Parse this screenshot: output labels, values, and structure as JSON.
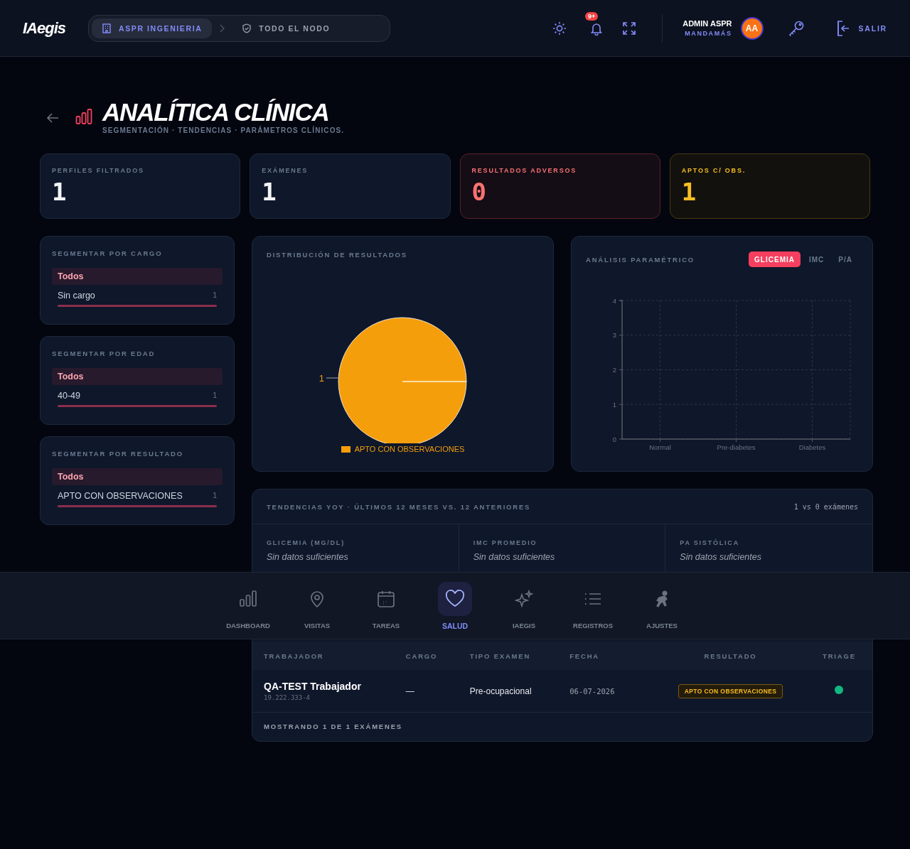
{
  "header": {
    "logo": "IAegis",
    "breadcrumb": [
      {
        "label": "ASPR INGENIERIA",
        "selected": true
      },
      {
        "label": "TODO EL NODO",
        "selected": false
      }
    ],
    "notifications": "9+",
    "user": {
      "name": "ADMIN ASPR",
      "role": "MANDAMÁS",
      "initials": "AA"
    },
    "logout": "SALIR"
  },
  "page": {
    "title": "ANALÍTICA CLÍNICA",
    "subtitle": "SEGMENTACIÓN · TENDENCIAS · PARÁMETROS CLÍNICOS."
  },
  "stats": [
    {
      "label": "PERFILES FILTRADOS",
      "value": "1",
      "kind": "neutral"
    },
    {
      "label": "EXÁMENES",
      "value": "1",
      "kind": "neutral"
    },
    {
      "label": "RESULTADOS ADVERSOS",
      "value": "0",
      "kind": "danger"
    },
    {
      "label": "APTOS C/ OBS.",
      "value": "1",
      "kind": "warning"
    }
  ],
  "filters": [
    {
      "title": "SEGMENTAR POR CARGO",
      "options": [
        {
          "label": "Todos",
          "selected": true
        },
        {
          "label": "Sin cargo",
          "count": "1",
          "level": 1,
          "selected": false
        }
      ]
    },
    {
      "title": "SEGMENTAR POR EDAD",
      "options": [
        {
          "label": "Todos",
          "selected": true
        },
        {
          "label": "40-49",
          "count": "1",
          "level": 1,
          "selected": false
        }
      ]
    },
    {
      "title": "SEGMENTAR POR RESULTADO",
      "options": [
        {
          "label": "Todos",
          "selected": true
        },
        {
          "label": "APTO CON OBSERVACIONES",
          "count": "1",
          "level": 1,
          "selected": false
        }
      ]
    }
  ],
  "distribution": {
    "title": "DISTRIBUCIÓN DE RESULTADOS",
    "chart_data": {
      "type": "pie",
      "categories": [
        "APTO CON OBSERVACIONES"
      ],
      "series": [
        {
          "color": "#f59e0b",
          "values": [
            1
          ]
        }
      ],
      "data_labels": true
    }
  },
  "parametric": {
    "title": "ANÁLISIS PARAMÉTRICO",
    "tabs": [
      {
        "label": "GLICEMIA",
        "selected": true
      },
      {
        "label": "IMC",
        "selected": false
      },
      {
        "label": "P/A",
        "selected": false
      }
    ],
    "chart_data": {
      "type": "bar",
      "categories": [
        "Normal",
        "Pre-diabetes",
        "Diabetes"
      ],
      "values": [
        0,
        0,
        0
      ],
      "ylim": [
        0,
        4
      ],
      "yticks": [
        0,
        1,
        2,
        3,
        4
      ],
      "grid": true
    }
  },
  "trends": {
    "title": "TENDENCIAS YOY · ÚLTIMOS 12 MESES VS. 12 ANTERIORES",
    "meta": "1 vs 0 exámenes",
    "metrics": [
      {
        "label": "GLICEMIA (MG/DL)",
        "value": "Sin datos suficientes"
      },
      {
        "label": "IMC PROMEDIO",
        "value": "Sin datos suficientes"
      },
      {
        "label": "PA SISTÓLICA",
        "value": "Sin datos suficientes"
      }
    ]
  },
  "table": {
    "columns": [
      "TRABAJADOR",
      "CARGO",
      "TIPO EXAMEN",
      "FECHA",
      "RESULTADO",
      "TRIAGE"
    ],
    "rows": [
      {
        "name": "QA-TEST Trabajador",
        "rut": "19.222.333-4",
        "cargo": "—",
        "tipo": "Pre-ocupacional",
        "fecha": "06-07-2026",
        "resultado": "APTO CON OBSERVACIONES",
        "triage": {
          "color": "#10b981"
        }
      }
    ],
    "footer": "MOSTRANDO 1 DE 1 EXÁMENES"
  },
  "bottom_nav": [
    {
      "label": "DASHBOARD",
      "selected": false
    },
    {
      "label": "VISITAS",
      "selected": false
    },
    {
      "label": "TAREAS",
      "selected": false
    },
    {
      "label": "SALUD",
      "selected": true
    },
    {
      "label": "IAEGIS",
      "selected": false
    },
    {
      "label": "REGISTROS",
      "selected": false
    },
    {
      "label": "AJUSTES",
      "selected": false
    }
  ]
}
